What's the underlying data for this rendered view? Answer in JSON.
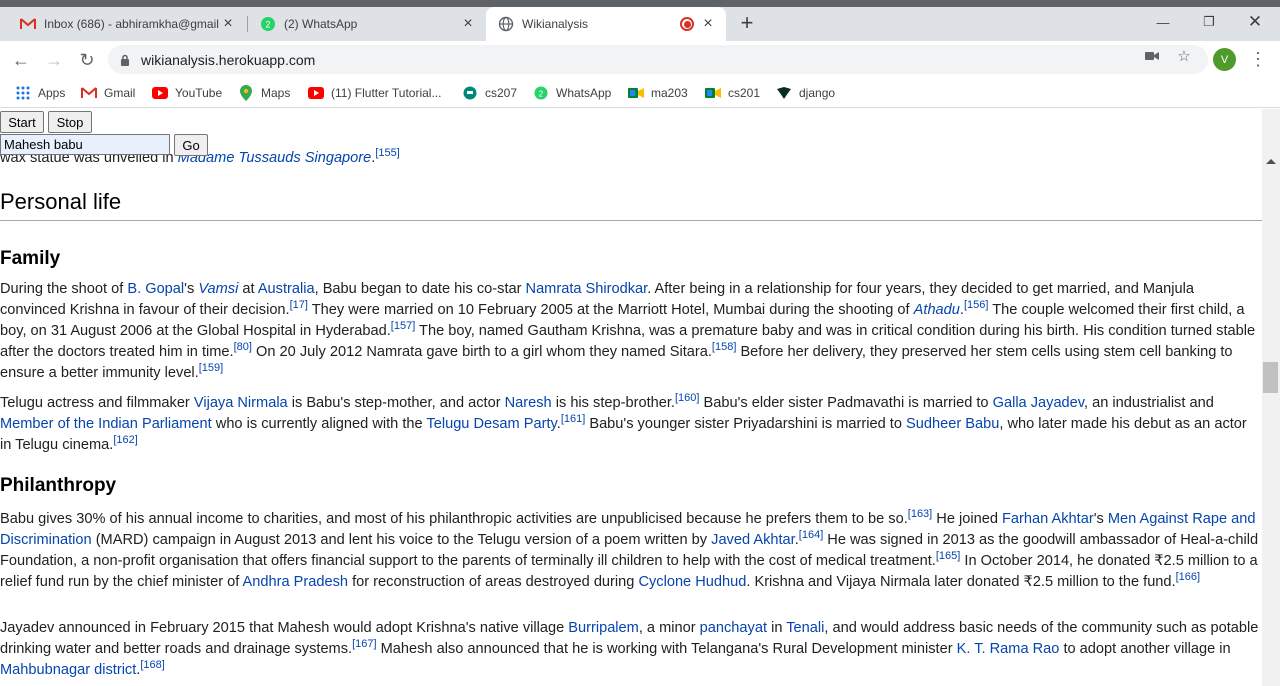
{
  "browser": {
    "tabs": [
      {
        "title": "Inbox (686) - abhiramkha@gmail",
        "icon": "gmail-icon"
      },
      {
        "title": "(2) WhatsApp",
        "icon": "whatsapp-icon"
      },
      {
        "title": "Wikianalysis",
        "icon": "globe-icon"
      }
    ],
    "url": "wikianalysis.herokuapp.com",
    "profile_initial": "V",
    "bookmarks": [
      "Apps",
      "Gmail",
      "YouTube",
      "Maps",
      "(11) Flutter Tutorial...",
      "cs207",
      "WhatsApp",
      "ma203",
      "cs201",
      "django"
    ]
  },
  "controls": {
    "start_label": "Start",
    "stop_label": "Stop",
    "search_value": "Mahesh babu",
    "go_label": "Go"
  },
  "article": {
    "top_line": {
      "text": "wax statue was unveiled in ",
      "link": "Madame Tussauds Singapore",
      "ref": "[155]"
    },
    "section_title": "Personal life",
    "family_heading": "Family",
    "family_p1": {
      "parts": [
        "During the shoot of ",
        "B. Gopal",
        "'s ",
        "Vamsi",
        " at ",
        "Australia",
        ", Babu began to date his co-star ",
        "Namrata Shirodkar",
        ". After being in a relationship for four years, they decided to get married, and Manjula convinced Krishna in favour of their decision.",
        "[17]",
        " They were married on 10 February 2005 at the Marriott Hotel, Mumbai during the shooting of ",
        "Athadu",
        ".",
        "[156]",
        " The couple welcomed their first child, a boy, on 31 August 2006 at the Global Hospital in Hyderabad.",
        "[157]",
        " The boy, named Gautham Krishna, was a premature baby and was in critical condition during his birth. His condition turned stable after the doctors treated him in time.",
        "[80]",
        " On 20 July 2012 Namrata gave birth to a girl whom they named Sitara.",
        "[158]",
        " Before her delivery, they preserved her stem cells using stem cell banking to ensure a better immunity level.",
        "[159]"
      ]
    },
    "family_p2": {
      "parts": [
        "Telugu actress and filmmaker ",
        "Vijaya Nirmala",
        " is Babu's step-mother, and actor ",
        "Naresh",
        " is his step-brother.",
        "[160]",
        " Babu's elder sister Padmavathi is married to ",
        "Galla Jayadev",
        ", an industrialist and ",
        "Member of the Indian Parliament",
        " who is currently aligned with the ",
        "Telugu Desam Party",
        ".",
        "[161]",
        " Babu's younger sister Priyadarshini is married to ",
        "Sudheer Babu",
        ", who later made his debut as an actor in Telugu cinema.",
        "[162]"
      ]
    },
    "philanthropy_heading": "Philanthropy",
    "phil_p1": {
      "parts": [
        "Babu gives 30% of his annual income to charities, and most of his philanthropic activities are unpublicised because he prefers them to be so.",
        "[163]",
        " He joined ",
        "Farhan Akhtar",
        "'s ",
        "Men Against Rape and Discrimination",
        " (MARD) campaign in August 2013 and lent his voice to the Telugu version of a poem written by ",
        "Javed Akhtar",
        ".",
        "[164]",
        " He was signed in 2013 as the goodwill ambassador of Heal-a-child Foundation, a non-profit organisation that offers financial support to the parents of terminally ill children to help with the cost of medical treatment.",
        "[165]",
        " In October 2014, he donated ₹2.5 million to a relief fund run by the chief minister of ",
        "Andhra Pradesh",
        " for reconstruction of areas destroyed during ",
        "Cyclone Hudhud",
        ". Krishna and Vijaya Nirmala later donated ₹2.5 million to the fund.",
        "[166]"
      ]
    },
    "phil_p2": {
      "parts": [
        "Jayadev announced in February 2015 that Mahesh would adopt Krishna's native village ",
        "Burripalem",
        ", a minor ",
        "panchayat",
        " in ",
        "Tenali",
        ", and would address basic needs of the community such as potable drinking water and better roads and drainage systems.",
        "[167]",
        " Mahesh also announced that he is working with Telangana's Rural Development minister ",
        "K. T. Rama Rao",
        " to adopt another village in ",
        "Mahbubnagar district",
        ".",
        "[168]"
      ]
    }
  }
}
